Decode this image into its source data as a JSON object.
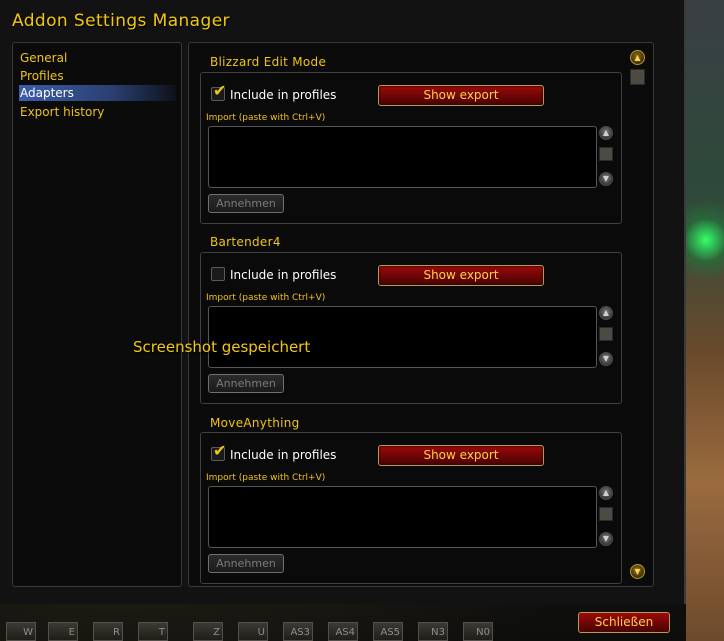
{
  "window": {
    "title": "Addon Settings Manager"
  },
  "nav": {
    "items": [
      {
        "label": "General",
        "selected": false
      },
      {
        "label": "Profiles",
        "selected": false
      },
      {
        "label": "Adapters",
        "selected": true
      },
      {
        "label": "Export history",
        "selected": false
      }
    ]
  },
  "sections": [
    {
      "title": "Blizzard Edit Mode",
      "include_checked": true,
      "include_label": "Include in profiles",
      "export_label": "Show export",
      "import_label": "Import (paste with Ctrl+V)",
      "import_value": "",
      "accept_label": "Annehmen"
    },
    {
      "title": "Bartender4",
      "include_checked": false,
      "include_label": "Include in profiles",
      "export_label": "Show export",
      "import_label": "Import (paste with Ctrl+V)",
      "import_value": "",
      "accept_label": "Annehmen"
    },
    {
      "title": "MoveAnything",
      "include_checked": true,
      "include_label": "Include in profiles",
      "export_label": "Show export",
      "import_label": "Import (paste with Ctrl+V)",
      "import_value": "",
      "accept_label": "Annehmen"
    }
  ],
  "toast": {
    "text": "Screenshot gespeichert"
  },
  "footer": {
    "close_label": "Schließen"
  },
  "actionbar": {
    "slots": [
      "W",
      "E",
      "R",
      "T",
      "Z",
      "U",
      "AS3",
      "AS4",
      "AS5",
      "N3",
      "N0"
    ]
  },
  "icons": {
    "checkmark": "✔",
    "scroll_up": "▲",
    "scroll_down": "▼"
  },
  "colors": {
    "gold_text": "#f0c414",
    "button_red": "#7a0606",
    "selected_nav": "#3a5ea8"
  }
}
